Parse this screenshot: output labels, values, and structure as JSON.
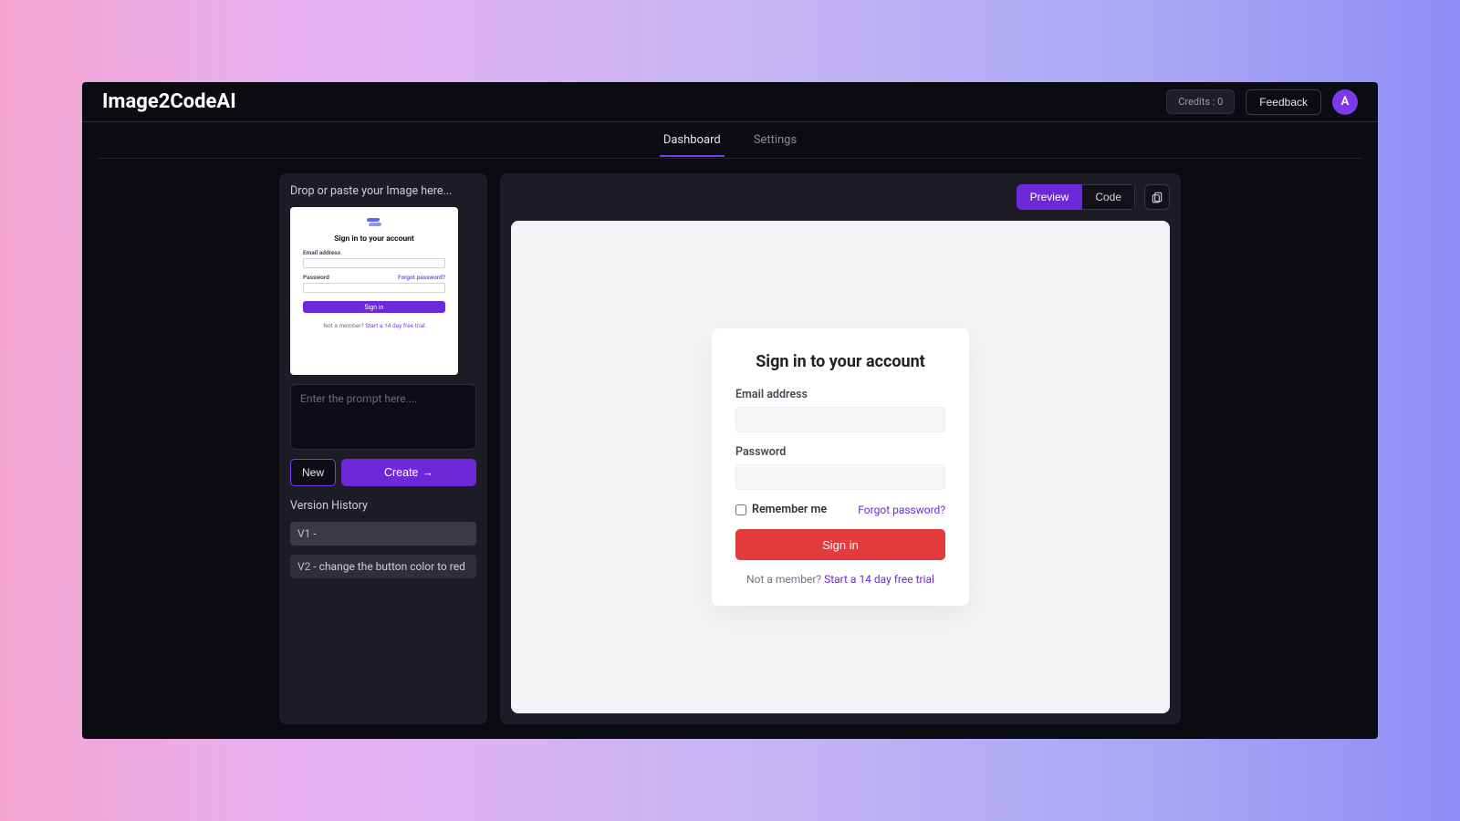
{
  "header": {
    "app_title": "Image2CodeAI",
    "credits_label": "Credits : 0",
    "feedback_label": "Feedback",
    "avatar_letter": "A"
  },
  "tabs": {
    "dashboard": "Dashboard",
    "settings": "Settings"
  },
  "left": {
    "drop_label": "Drop or paste your Image here...",
    "prompt_placeholder": "Enter the prompt here....",
    "new_label": "New",
    "create_label": "Create",
    "create_arrow": "→",
    "version_history_title": "Version History",
    "versions": [
      {
        "tag": "V1",
        "desc": " - "
      },
      {
        "tag": "V2",
        "desc": " - change the button color to red"
      }
    ]
  },
  "thumb": {
    "title": "Sign in to your account",
    "email_label": "Email address",
    "password_label": "Password",
    "forgot": "Forgot password?",
    "signin": "Sign in",
    "footer_lead": "Not a member? ",
    "footer_link": "Start a 14 day free trial"
  },
  "right": {
    "preview_label": "Preview",
    "code_label": "Code"
  },
  "signin": {
    "title": "Sign in to your account",
    "email_label": "Email address",
    "password_label": "Password",
    "remember_label": "Remember me",
    "forgot_label": "Forgot password?",
    "signin_button": "Sign in",
    "footer_lead": "Not a member? ",
    "footer_link": "Start a 14 day free trial"
  }
}
